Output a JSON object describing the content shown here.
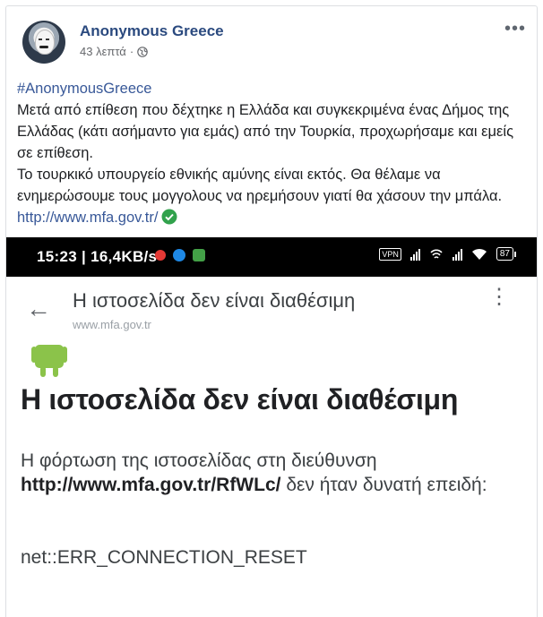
{
  "post": {
    "page_name": "Anonymous Greece",
    "time_ago": "43 λεπτά",
    "dot": "·",
    "more": "•••",
    "hashtag": "#AnonymousGreece",
    "line1": "Μετά από επίθεση που δέχτηκε η Ελλάδα και συγκεκριμένα ένας Δήμος της Ελλάδας (κάτι ασήμαντο για εμάς) από την Τουρκία, προχωρήσαμε και εμείς σε επίθεση.",
    "line2": "Το τουρκικό υπουργείο εθνικής αμύνης είναι εκτός. Θα θέλαμε να ενημερώσουμε τους μογγολους να ηρεμήσουν γιατί θα χάσουν την μπάλα.",
    "link": "http://www.mfa.gov.tr/"
  },
  "screenshot": {
    "status_time": "15:23 | 16,4KB/s",
    "vpn": "VPN",
    "battery": "87",
    "tab_title": "Η ιστοσελίδα δεν είναι διαθέσιμη",
    "tab_url": "www.mfa.gov.tr",
    "error_heading": "Η ιστοσελίδα δεν είναι διαθέσιμη",
    "error_desc_prefix": "Η φόρτωση της ιστοσελίδας στη διεύθυνση",
    "error_url": "http://www.mfa.gov.tr/RfWLc/",
    "error_desc_suffix": "δεν ήταν δυνατή επειδή:",
    "error_code": "net::ERR_CONNECTION_RESET"
  },
  "colors": {
    "link": "#385898",
    "name": "#2b4a7f",
    "verified": "#31a24c"
  },
  "icons": [
    "avatar",
    "globe-icon",
    "more-icon",
    "check-icon",
    "back-icon",
    "kebab-icon",
    "android-icon",
    "wifi-icon",
    "signal-icon",
    "battery-icon"
  ]
}
